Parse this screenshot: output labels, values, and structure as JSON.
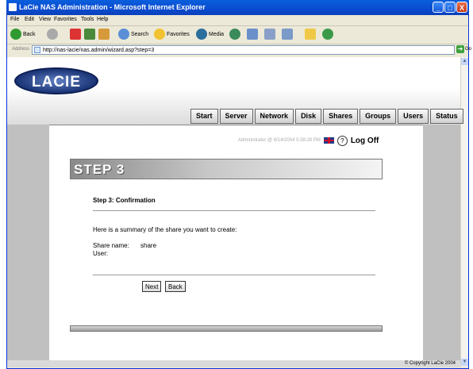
{
  "window": {
    "title": "LaCie NAS Administration - Microsoft Internet Explorer",
    "controls": [
      "_",
      "□",
      "X"
    ]
  },
  "menu": [
    "File",
    "Edit",
    "View",
    "Favorites",
    "Tools",
    "Help"
  ],
  "toolbar": {
    "back": "Back",
    "search": "Search",
    "favorites": "Favorites",
    "media": "Media"
  },
  "address": {
    "label": "Address",
    "url": "http://nas-lacie/nas.admin/wizard.asp?step=3",
    "go": "Go"
  },
  "logo": {
    "text": "LACIE"
  },
  "nav": [
    "Start",
    "Server",
    "Network",
    "Disk",
    "Shares",
    "Groups",
    "Users",
    "Status"
  ],
  "status": {
    "session": "Administrator @ 8/14/2004 5:38:28 PM",
    "logoff": "Log Off"
  },
  "step": {
    "banner": "STEP 3",
    "heading": "Step 3: Confirmation",
    "summary": "Here is a summary of the share you want to create:",
    "share_name_label": "Share name:",
    "share_name_value": "share",
    "user_label": "User:"
  },
  "buttons": {
    "next": "Next",
    "back": "Back"
  },
  "footer": {
    "copyright": "© Copyright LaCie 2004"
  }
}
